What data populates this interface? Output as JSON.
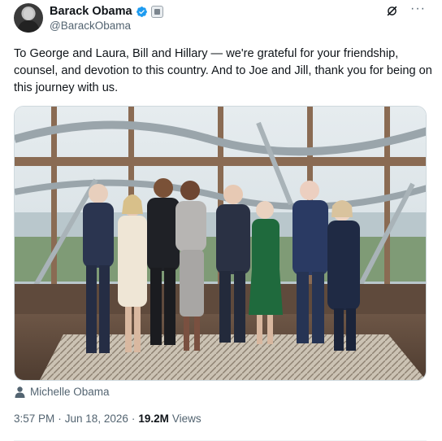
{
  "author": {
    "display_name": "Barack Obama",
    "handle": "@BarackObama",
    "verified": true,
    "avatar_icon": "user-avatar",
    "badge_icon": "government-badge-icon"
  },
  "actions": {
    "grok_icon": "grok-icon",
    "more_label": "···"
  },
  "tweet": {
    "text": "To George and Laura, Bill and Hillary — we're grateful for your friendship, counsel, and devotion to this country. And to Joe and Jill, thank you for being on this journey with us."
  },
  "media": {
    "description_icon": "photo",
    "tagged_user": "Michelle Obama"
  },
  "meta": {
    "time": "3:57 PM",
    "separator": "·",
    "date": "Jun 18, 2026",
    "views_count": "19.2M",
    "views_label": "Views"
  },
  "colors": {
    "text_primary": "#0f1419",
    "text_secondary": "#536471",
    "verified_blue": "#1d9bf0",
    "border": "#cfd9de"
  }
}
